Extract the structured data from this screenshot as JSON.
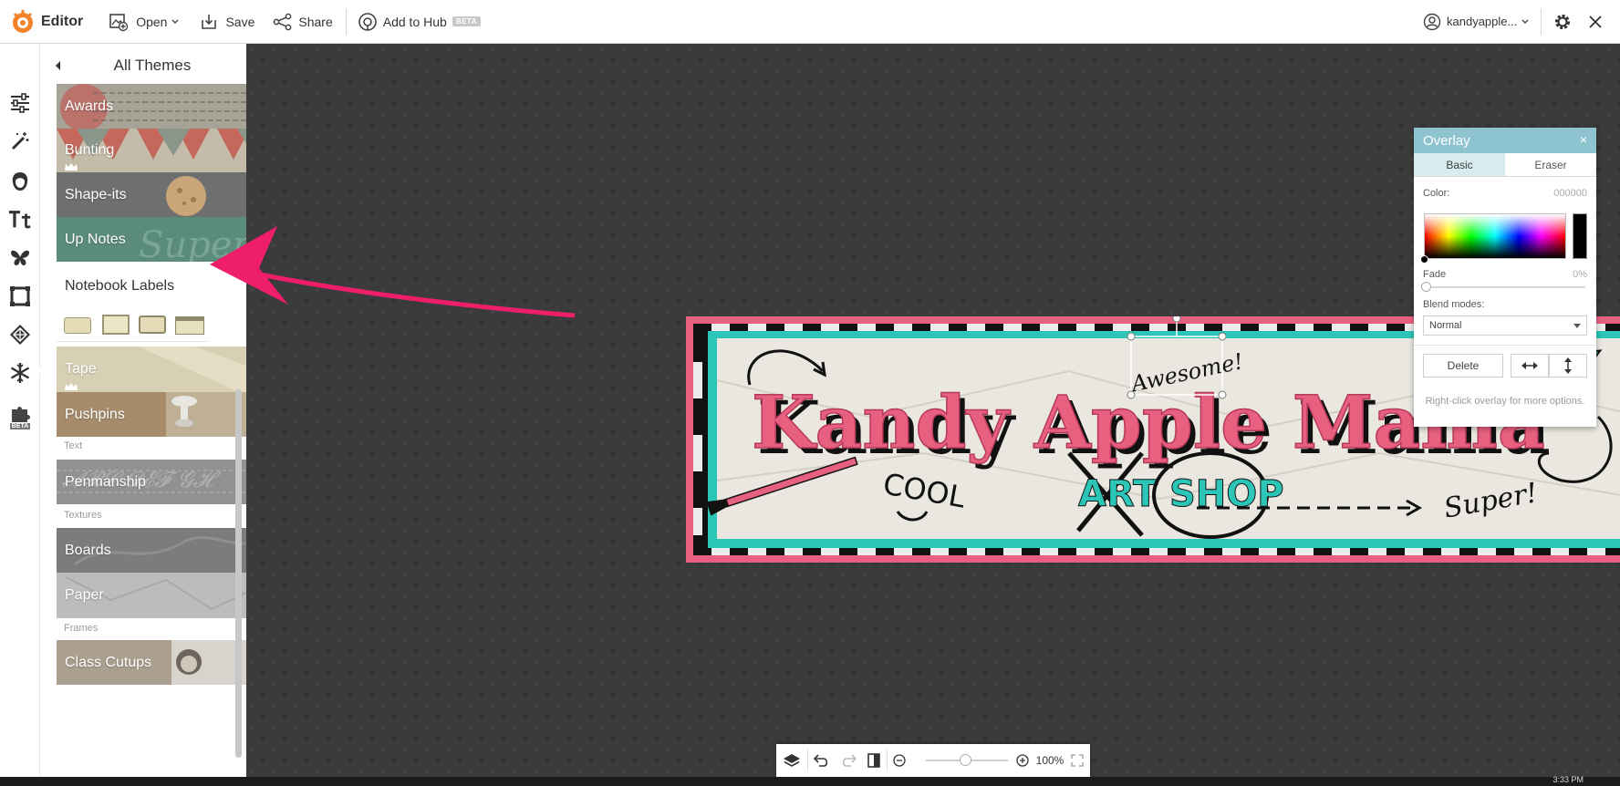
{
  "topbar": {
    "app_name": "Editor",
    "open_label": "Open",
    "save_label": "Save",
    "share_label": "Share",
    "hub_label": "Add to Hub",
    "hub_badge": "BETA",
    "account_name": "kandyapple..."
  },
  "rail": {
    "items": [
      "sliders-icon",
      "magic-wand-icon",
      "face-icon",
      "text-icon",
      "butterfly-icon",
      "frame-icon",
      "texture-icon",
      "snowflake-icon",
      "puzzle-icon"
    ],
    "beta_badge": "BETA"
  },
  "panel": {
    "title": "All Themes",
    "themes": [
      {
        "label": "Awards",
        "premium": false
      },
      {
        "label": "Bunting",
        "premium": true
      },
      {
        "label": "Shape-its",
        "premium": false
      },
      {
        "label": "Up Notes",
        "premium": false
      },
      {
        "label": "Notebook Labels",
        "premium": false
      },
      {
        "label": "Tape",
        "premium": true
      },
      {
        "label": "Pushpins",
        "premium": false
      },
      {
        "label": "Penmanship",
        "premium": false
      },
      {
        "label": "Boards",
        "premium": false
      },
      {
        "label": "Paper",
        "premium": false
      },
      {
        "label": "Class Cutups",
        "premium": false
      }
    ],
    "sections": [
      "Text",
      "Textures",
      "Frames"
    ]
  },
  "banner": {
    "title": "Kandy Apple Mama",
    "subtitle_left": "ART",
    "subtitle_right": "SHOP",
    "doodle_cool": "COOL",
    "doodle_super": "Super!",
    "doodle_awesome": "Awesome!",
    "colors": {
      "pink": "#e8607f",
      "teal": "#2cc6b8",
      "black": "#111111",
      "paper": "#e9e7df"
    }
  },
  "overlay": {
    "title": "Overlay",
    "close": "×",
    "tabs": [
      "Basic",
      "Eraser"
    ],
    "active_tab": "Basic",
    "color_label": "Color:",
    "color_value": "000000",
    "fade_label": "Fade",
    "fade_value": "0%",
    "blend_label": "Blend modes:",
    "blend_value": "Normal",
    "delete_label": "Delete",
    "hint": "Right-click overlay for more options."
  },
  "bottombar": {
    "zoom": "100%"
  },
  "taskbar": {
    "time": "3:33 PM"
  }
}
